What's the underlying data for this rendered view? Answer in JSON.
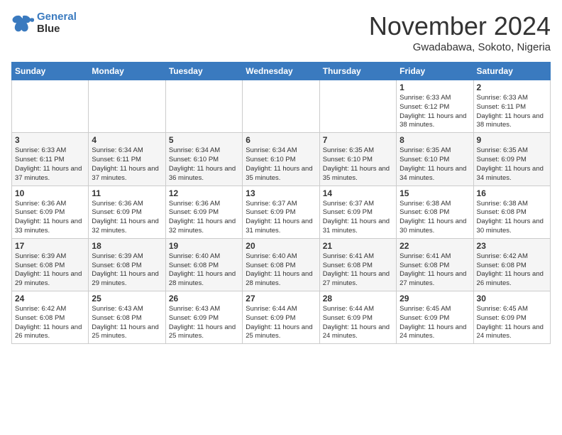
{
  "header": {
    "logo_line1": "General",
    "logo_line2": "Blue",
    "month_title": "November 2024",
    "location": "Gwadabawa, Sokoto, Nigeria"
  },
  "weekdays": [
    "Sunday",
    "Monday",
    "Tuesday",
    "Wednesday",
    "Thursday",
    "Friday",
    "Saturday"
  ],
  "weeks": [
    [
      {
        "day": "",
        "info": ""
      },
      {
        "day": "",
        "info": ""
      },
      {
        "day": "",
        "info": ""
      },
      {
        "day": "",
        "info": ""
      },
      {
        "day": "",
        "info": ""
      },
      {
        "day": "1",
        "info": "Sunrise: 6:33 AM\nSunset: 6:12 PM\nDaylight: 11 hours and 38 minutes."
      },
      {
        "day": "2",
        "info": "Sunrise: 6:33 AM\nSunset: 6:11 PM\nDaylight: 11 hours and 38 minutes."
      }
    ],
    [
      {
        "day": "3",
        "info": "Sunrise: 6:33 AM\nSunset: 6:11 PM\nDaylight: 11 hours and 37 minutes."
      },
      {
        "day": "4",
        "info": "Sunrise: 6:34 AM\nSunset: 6:11 PM\nDaylight: 11 hours and 37 minutes."
      },
      {
        "day": "5",
        "info": "Sunrise: 6:34 AM\nSunset: 6:10 PM\nDaylight: 11 hours and 36 minutes."
      },
      {
        "day": "6",
        "info": "Sunrise: 6:34 AM\nSunset: 6:10 PM\nDaylight: 11 hours and 35 minutes."
      },
      {
        "day": "7",
        "info": "Sunrise: 6:35 AM\nSunset: 6:10 PM\nDaylight: 11 hours and 35 minutes."
      },
      {
        "day": "8",
        "info": "Sunrise: 6:35 AM\nSunset: 6:10 PM\nDaylight: 11 hours and 34 minutes."
      },
      {
        "day": "9",
        "info": "Sunrise: 6:35 AM\nSunset: 6:09 PM\nDaylight: 11 hours and 34 minutes."
      }
    ],
    [
      {
        "day": "10",
        "info": "Sunrise: 6:36 AM\nSunset: 6:09 PM\nDaylight: 11 hours and 33 minutes."
      },
      {
        "day": "11",
        "info": "Sunrise: 6:36 AM\nSunset: 6:09 PM\nDaylight: 11 hours and 32 minutes."
      },
      {
        "day": "12",
        "info": "Sunrise: 6:36 AM\nSunset: 6:09 PM\nDaylight: 11 hours and 32 minutes."
      },
      {
        "day": "13",
        "info": "Sunrise: 6:37 AM\nSunset: 6:09 PM\nDaylight: 11 hours and 31 minutes."
      },
      {
        "day": "14",
        "info": "Sunrise: 6:37 AM\nSunset: 6:09 PM\nDaylight: 11 hours and 31 minutes."
      },
      {
        "day": "15",
        "info": "Sunrise: 6:38 AM\nSunset: 6:08 PM\nDaylight: 11 hours and 30 minutes."
      },
      {
        "day": "16",
        "info": "Sunrise: 6:38 AM\nSunset: 6:08 PM\nDaylight: 11 hours and 30 minutes."
      }
    ],
    [
      {
        "day": "17",
        "info": "Sunrise: 6:39 AM\nSunset: 6:08 PM\nDaylight: 11 hours and 29 minutes."
      },
      {
        "day": "18",
        "info": "Sunrise: 6:39 AM\nSunset: 6:08 PM\nDaylight: 11 hours and 29 minutes."
      },
      {
        "day": "19",
        "info": "Sunrise: 6:40 AM\nSunset: 6:08 PM\nDaylight: 11 hours and 28 minutes."
      },
      {
        "day": "20",
        "info": "Sunrise: 6:40 AM\nSunset: 6:08 PM\nDaylight: 11 hours and 28 minutes."
      },
      {
        "day": "21",
        "info": "Sunrise: 6:41 AM\nSunset: 6:08 PM\nDaylight: 11 hours and 27 minutes."
      },
      {
        "day": "22",
        "info": "Sunrise: 6:41 AM\nSunset: 6:08 PM\nDaylight: 11 hours and 27 minutes."
      },
      {
        "day": "23",
        "info": "Sunrise: 6:42 AM\nSunset: 6:08 PM\nDaylight: 11 hours and 26 minutes."
      }
    ],
    [
      {
        "day": "24",
        "info": "Sunrise: 6:42 AM\nSunset: 6:08 PM\nDaylight: 11 hours and 26 minutes."
      },
      {
        "day": "25",
        "info": "Sunrise: 6:43 AM\nSunset: 6:08 PM\nDaylight: 11 hours and 25 minutes."
      },
      {
        "day": "26",
        "info": "Sunrise: 6:43 AM\nSunset: 6:09 PM\nDaylight: 11 hours and 25 minutes."
      },
      {
        "day": "27",
        "info": "Sunrise: 6:44 AM\nSunset: 6:09 PM\nDaylight: 11 hours and 25 minutes."
      },
      {
        "day": "28",
        "info": "Sunrise: 6:44 AM\nSunset: 6:09 PM\nDaylight: 11 hours and 24 minutes."
      },
      {
        "day": "29",
        "info": "Sunrise: 6:45 AM\nSunset: 6:09 PM\nDaylight: 11 hours and 24 minutes."
      },
      {
        "day": "30",
        "info": "Sunrise: 6:45 AM\nSunset: 6:09 PM\nDaylight: 11 hours and 24 minutes."
      }
    ]
  ]
}
